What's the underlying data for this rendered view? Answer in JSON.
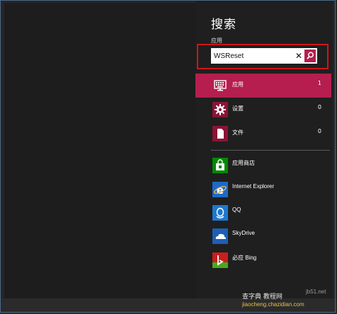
{
  "charm": {
    "title": "搜索",
    "scope_label": "应用",
    "search": {
      "value": "WSReset",
      "clear_glyph": "✕"
    }
  },
  "categories": [
    {
      "label": "应用",
      "count": "1",
      "icon": "keyboard-icon",
      "selected": true
    },
    {
      "label": "设置",
      "count": "0",
      "icon": "gear-icon"
    },
    {
      "label": "文件",
      "count": "0",
      "icon": "file-icon"
    }
  ],
  "apps": [
    {
      "label": "应用商店",
      "icon": "store-icon",
      "color": "#008a00"
    },
    {
      "label": "Internet Explorer",
      "icon": "ie-icon",
      "color": "#1e6ac8"
    },
    {
      "label": "QQ",
      "icon": "qq-icon",
      "color": "#1e78d0"
    },
    {
      "label": "SkyDrive",
      "icon": "skydrive-icon",
      "color": "#1e5fb4"
    },
    {
      "label": "必应 Bing",
      "icon": "bing-icon",
      "color": "#c81e1e"
    }
  ],
  "watermark": {
    "site_line": "查字典 教程网",
    "url_line": "jiaocheng.chazidian.com",
    "corner": "jb51.net"
  },
  "colors": {
    "accent": "#b51e4e",
    "highlight_outline": "#d2141a"
  }
}
